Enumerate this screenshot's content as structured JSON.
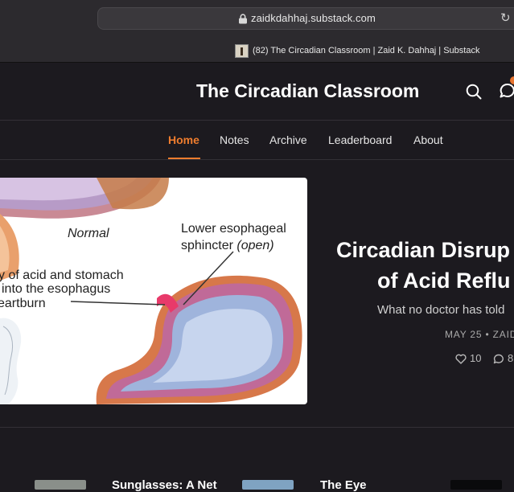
{
  "browser": {
    "url": "zaidkdahhaj.substack.com",
    "tab_title": "(82) The Circadian Classroom | Zaid K. Dahhaj | Substack"
  },
  "site": {
    "title": "The Circadian Classroom",
    "icons": [
      "search-icon",
      "chat-icon"
    ],
    "accent_color": "#ef7d2e"
  },
  "nav": {
    "items": [
      {
        "label": "Home",
        "active": true
      },
      {
        "label": "Notes",
        "active": false
      },
      {
        "label": "Archive",
        "active": false
      },
      {
        "label": "Leaderboard",
        "active": false
      },
      {
        "label": "About",
        "active": false
      }
    ]
  },
  "hero": {
    "image_labels": {
      "normal": "Normal",
      "sphincter_line1": "Lower esophageal",
      "sphincter_line2": "sphincter",
      "sphincter_open": "(open)",
      "flow_line1": "y of acid and stomach",
      "flow_line2": "into the esophagus",
      "flow_line3": "eartburn"
    },
    "title_line1": "Circadian Disrup",
    "title_line2": "of Acid Reflu",
    "subtitle": "What no doctor has told",
    "meta": "MAY 25 • ZAID",
    "likes": "10",
    "comments": "8"
  },
  "cards": [
    {
      "title": "Sunglasses: A Net"
    },
    {
      "title": "The Eye"
    }
  ]
}
